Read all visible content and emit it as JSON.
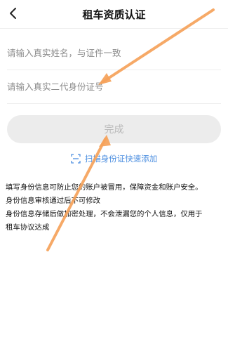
{
  "header": {
    "title": "租车资质认证",
    "back_icon": "chevron-left-icon"
  },
  "form": {
    "name_placeholder": "请输入真实姓名，与证件一致",
    "id_placeholder": "请输入真实二代身份证号",
    "submit_label": "完成"
  },
  "scan": {
    "label": "扫描身份证快速添加",
    "icon": "scan-icon",
    "color": "#4d8fe0"
  },
  "notes": [
    "填写身份信息可防止您的账户被冒用，保障资金和账户安全。",
    "身份信息审核通过后不可修改",
    "身份信息存储后做加密处理，不会泄漏您的个人信息，仅用于",
    "租车协议达成"
  ],
  "annotation_color": "#f5a25a"
}
